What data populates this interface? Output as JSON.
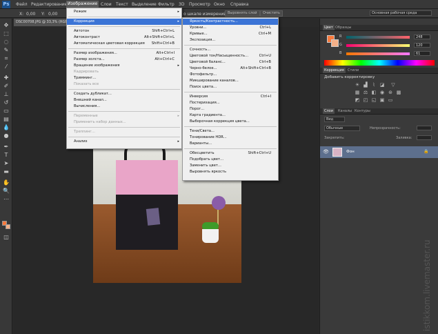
{
  "app": {
    "logo": "Ps"
  },
  "menubar": {
    "items": [
      "Файл",
      "Редактирование",
      "Изображение",
      "Слои",
      "Текст",
      "Выделение",
      "Фильтр",
      "3D",
      "Просмотр",
      "Окно",
      "Справка"
    ]
  },
  "options": {
    "x_label": "X:",
    "x_value": "0,00",
    "y_label": "Y:",
    "y_value": "0,00",
    "sample_label": "о шкале измерений",
    "select_layer_btn": "Выровнять слой",
    "clear_btn": "Очистить",
    "workspace": "Основная рабочая среда"
  },
  "document": {
    "tab": "DSC00708.JPG @ 33,3% (RGB"
  },
  "image_menu": {
    "items": [
      {
        "label": "Режим",
        "shortcut": "",
        "submenu": true,
        "disabled": false
      },
      {
        "sep": true
      },
      {
        "label": "Коррекция",
        "shortcut": "",
        "submenu": true,
        "disabled": false,
        "highlight": true
      },
      {
        "sep": true
      },
      {
        "label": "Автотон",
        "shortcut": "Shift+Ctrl+L",
        "disabled": false
      },
      {
        "label": "Автоконтраст",
        "shortcut": "Alt+Shift+Ctrl+L",
        "disabled": false
      },
      {
        "label": "Автоматическая цветовая коррекция",
        "shortcut": "Shift+Ctrl+B",
        "disabled": false
      },
      {
        "sep": true
      },
      {
        "label": "Размер изображения...",
        "shortcut": "Alt+Ctrl+I",
        "disabled": false
      },
      {
        "label": "Размер холста...",
        "shortcut": "Alt+Ctrl+C",
        "disabled": false
      },
      {
        "label": "Вращение изображения",
        "shortcut": "",
        "submenu": true,
        "disabled": false
      },
      {
        "label": "Кадрировать",
        "shortcut": "",
        "disabled": true
      },
      {
        "label": "Тримминг...",
        "shortcut": "",
        "disabled": false
      },
      {
        "label": "Показать все",
        "shortcut": "",
        "disabled": true
      },
      {
        "sep": true
      },
      {
        "label": "Создать дубликат...",
        "shortcut": "",
        "disabled": false
      },
      {
        "label": "Внешний канал...",
        "shortcut": "",
        "disabled": false
      },
      {
        "label": "Вычисления...",
        "shortcut": "",
        "disabled": false
      },
      {
        "sep": true
      },
      {
        "label": "Переменные",
        "shortcut": "",
        "submenu": true,
        "disabled": true
      },
      {
        "label": "Применить набор данных...",
        "shortcut": "",
        "disabled": true
      },
      {
        "sep": true
      },
      {
        "label": "Треппинг...",
        "shortcut": "",
        "disabled": true
      },
      {
        "sep": true
      },
      {
        "label": "Анализ",
        "shortcut": "",
        "submenu": true,
        "disabled": false
      }
    ]
  },
  "correction_menu": {
    "items": [
      {
        "label": "Яркость/Контрастность...",
        "shortcut": "",
        "highlight": true
      },
      {
        "label": "Уровни...",
        "shortcut": "Ctrl+L"
      },
      {
        "label": "Кривые...",
        "shortcut": "Ctrl+M"
      },
      {
        "label": "Экспозиция...",
        "shortcut": ""
      },
      {
        "sep": true
      },
      {
        "label": "Сочность...",
        "shortcut": ""
      },
      {
        "label": "Цветовой тон/Насыщенность...",
        "shortcut": "Ctrl+U"
      },
      {
        "label": "Цветовой баланс...",
        "shortcut": "Ctrl+B"
      },
      {
        "label": "Черно-белое...",
        "shortcut": "Alt+Shift+Ctrl+B"
      },
      {
        "label": "Фотофильтр...",
        "shortcut": ""
      },
      {
        "label": "Микширование каналов...",
        "shortcut": ""
      },
      {
        "label": "Поиск цвета...",
        "shortcut": ""
      },
      {
        "sep": true
      },
      {
        "label": "Инверсия",
        "shortcut": "Ctrl+I"
      },
      {
        "label": "Постеризация...",
        "shortcut": ""
      },
      {
        "label": "Порог...",
        "shortcut": ""
      },
      {
        "label": "Карта градиента...",
        "shortcut": ""
      },
      {
        "label": "Выборочная коррекция цвета...",
        "shortcut": ""
      },
      {
        "sep": true
      },
      {
        "label": "Тени/Света...",
        "shortcut": ""
      },
      {
        "label": "Тонирование HDR...",
        "shortcut": ""
      },
      {
        "label": "Варианты...",
        "shortcut": ""
      },
      {
        "sep": true
      },
      {
        "label": "Обесцветить",
        "shortcut": "Shift+Ctrl+U"
      },
      {
        "label": "Подобрать цвет...",
        "shortcut": ""
      },
      {
        "label": "Заменить цвет...",
        "shortcut": ""
      },
      {
        "label": "Выровнять яркость",
        "shortcut": ""
      }
    ]
  },
  "color_panel": {
    "tabs": [
      "Цвет",
      "Образцы"
    ],
    "channels": [
      {
        "label": "R",
        "value": "248",
        "grad": "linear-gradient(90deg,#00636b,#ff636b)"
      },
      {
        "label": "G",
        "value": "120",
        "grad": "linear-gradient(90deg,#f80070,#f8ff70)"
      },
      {
        "label": "B",
        "value": "61",
        "grad": "linear-gradient(90deg,#f87800,#f878ff)"
      }
    ],
    "fg_color": "#f87a3d",
    "bg_color": "#f4b088"
  },
  "adjust_panel": {
    "tabs": [
      "Коррекция",
      "Стили"
    ],
    "hint": "Добавить корректировку"
  },
  "layers_panel": {
    "tabs": [
      "Слои",
      "Каналы",
      "Контуры"
    ],
    "kind": "Вид",
    "blend": "Обычные",
    "opacity_label": "Непрозрачность:",
    "lock_label": "Закрепить:",
    "fill_label": "Заливка:",
    "layer_name": "Фон"
  },
  "watermark": "istikkom.livemaster.ru"
}
